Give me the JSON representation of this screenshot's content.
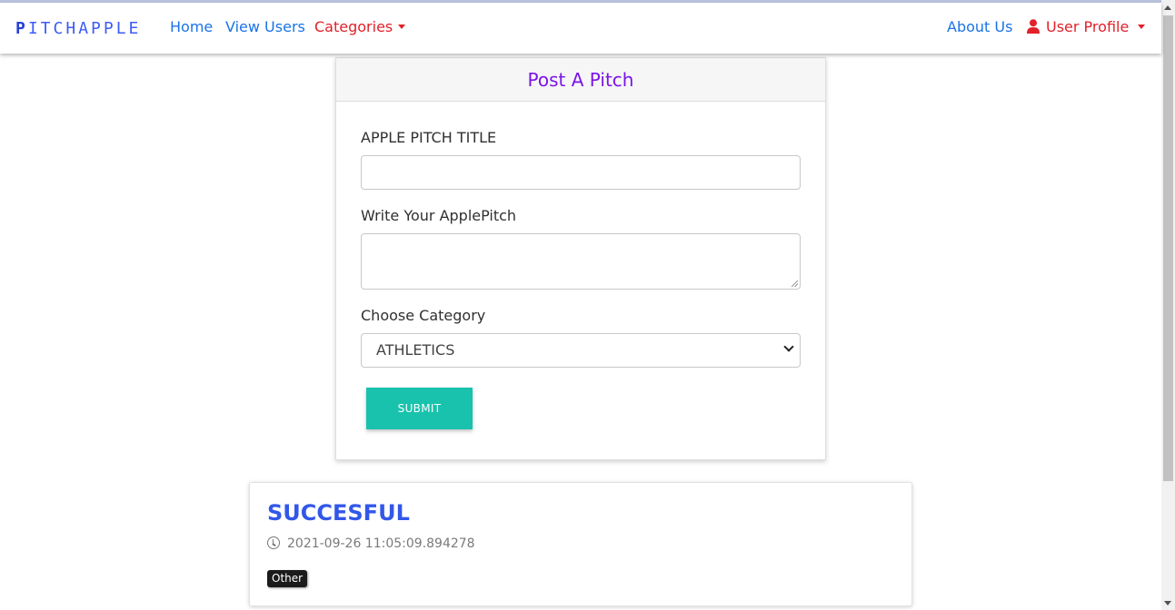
{
  "navbar": {
    "brand_first": "P",
    "brand_rest": "ITCHAPPLE",
    "home": "Home",
    "view_users": "View Users",
    "categories": "Categories",
    "about": "About Us",
    "user_profile": "User Profile"
  },
  "form": {
    "header": "Post A Pitch",
    "title_label": "APPLE PITCH TITLE",
    "title_value": "",
    "pitch_label": "Write Your ApplePitch",
    "pitch_value": "",
    "category_label": "Choose Category",
    "category_selected": "ATHLETICS",
    "submit": "SUBMIT"
  },
  "pitch": {
    "title": "SUCCESFUL",
    "timestamp": "2021-09-26 11:05:09.894278",
    "category_badge": "Other"
  },
  "icons": {
    "user": "user-icon",
    "clock": "clock-icon",
    "chevron": "chevron-down-icon"
  },
  "colors": {
    "brand": "#3d5cf5",
    "link": "#1a73e8",
    "accent_red": "#e2202a",
    "header_purple": "#7b14e8",
    "submit_teal": "#19c2ad",
    "pitch_title": "#3257e8"
  }
}
